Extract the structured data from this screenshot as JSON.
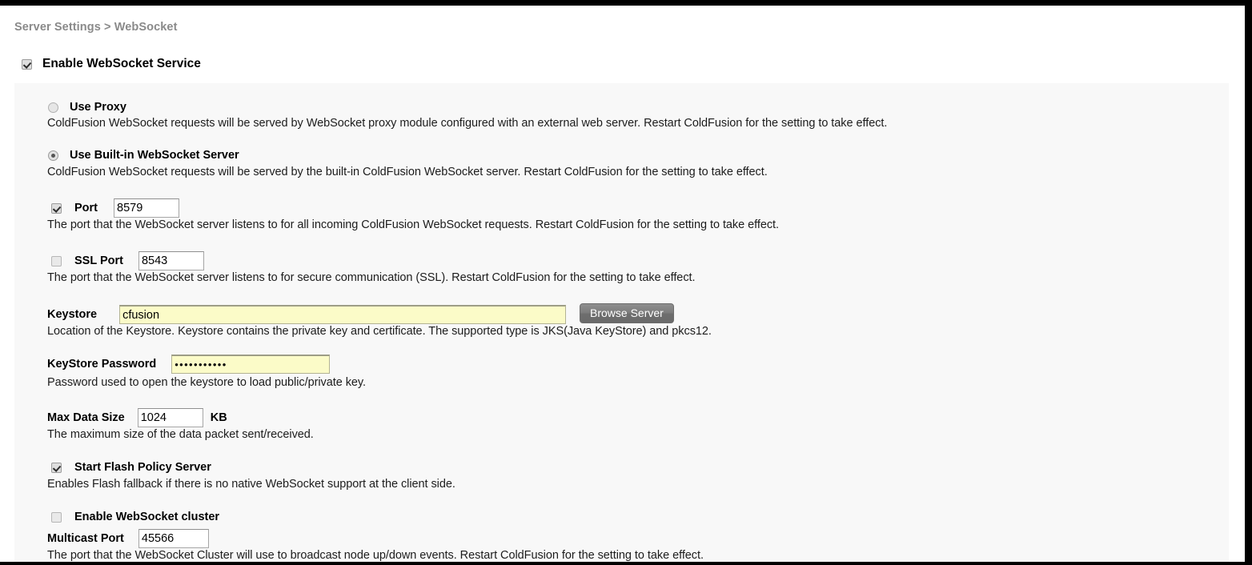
{
  "breadcrumb": "Server Settings > WebSocket",
  "enable_service": {
    "label": "Enable WebSocket Service",
    "checked": true
  },
  "options": {
    "use_proxy": {
      "label": "Use Proxy",
      "selected": false,
      "description": "ColdFusion WebSocket requests will be served by WebSocket proxy module configured with an external web server. Restart ColdFusion for the setting to take effect."
    },
    "use_builtin": {
      "label": "Use Built-in WebSocket Server",
      "selected": true,
      "description": "ColdFusion WebSocket requests will be served by the built-in ColdFusion WebSocket server. Restart ColdFusion for the setting to take effect."
    }
  },
  "fields": {
    "port": {
      "label": "Port",
      "value": "8579",
      "checked": true,
      "description": "The port that the WebSocket server listens to for all incoming ColdFusion WebSocket requests. Restart ColdFusion for the setting to take effect."
    },
    "ssl_port": {
      "label": "SSL Port",
      "value": "8543",
      "checked": false,
      "description": "The port that the WebSocket server listens to for secure communication (SSL). Restart ColdFusion for the setting to take effect."
    },
    "keystore": {
      "label": "Keystore",
      "value": "cfusion",
      "browse_label": "Browse Server",
      "description": "Location of the Keystore. Keystore contains the private key and certificate. The supported type is JKS(Java KeyStore) and pkcs12."
    },
    "keystore_password": {
      "label": "KeyStore Password",
      "value": "•••••••••••",
      "description": "Password used to open the keystore to load public/private key."
    },
    "max_data_size": {
      "label": "Max Data Size",
      "value": "1024",
      "unit": "KB",
      "description": "The maximum size of the data packet sent/received."
    },
    "flash_policy": {
      "label": "Start Flash Policy Server",
      "checked": true,
      "description": "Enables Flash fallback if there is no native WebSocket support at the client side."
    },
    "cluster": {
      "label": "Enable WebSocket cluster",
      "checked": false
    },
    "multicast_port": {
      "label": "Multicast Port",
      "value": "45566",
      "description": "The port that the WebSocket Cluster will use to broadcast node up/down events. Restart ColdFusion for the setting to take effect."
    }
  },
  "colors": {
    "panel_bg": "#f8f8f8",
    "autofill": "#fbfbc8",
    "breadcrumb_text": "#8a8a8a",
    "button_bg": "#7b7b7b"
  }
}
